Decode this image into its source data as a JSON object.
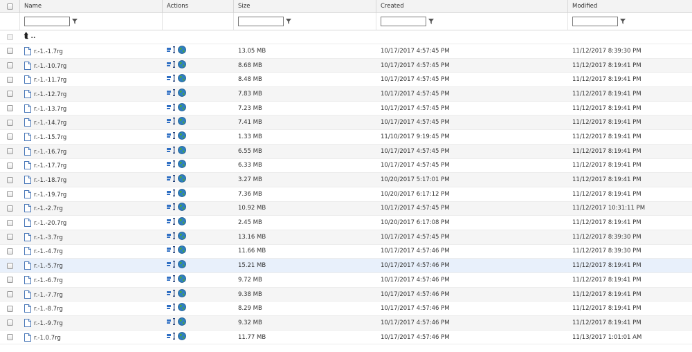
{
  "columns": {
    "name": "Name",
    "actions": "Actions",
    "size": "Size",
    "created": "Created",
    "modified": "Modified"
  },
  "parent_dir": {
    "label": ".."
  },
  "rows": [
    {
      "name": "r.-1.-1.7rg",
      "size": "13.05 MB",
      "created": "10/17/2017 4:57:45 PM",
      "modified": "11/12/2017 8:39:30 PM"
    },
    {
      "name": "r.-1.-10.7rg",
      "size": "8.68 MB",
      "created": "10/17/2017 4:57:45 PM",
      "modified": "11/12/2017 8:19:41 PM"
    },
    {
      "name": "r.-1.-11.7rg",
      "size": "8.48 MB",
      "created": "10/17/2017 4:57:45 PM",
      "modified": "11/12/2017 8:19:41 PM"
    },
    {
      "name": "r.-1.-12.7rg",
      "size": "7.83 MB",
      "created": "10/17/2017 4:57:45 PM",
      "modified": "11/12/2017 8:19:41 PM"
    },
    {
      "name": "r.-1.-13.7rg",
      "size": "7.23 MB",
      "created": "10/17/2017 4:57:45 PM",
      "modified": "11/12/2017 8:19:41 PM"
    },
    {
      "name": "r.-1.-14.7rg",
      "size": "7.41 MB",
      "created": "10/17/2017 4:57:45 PM",
      "modified": "11/12/2017 8:19:41 PM"
    },
    {
      "name": "r.-1.-15.7rg",
      "size": "1.33 MB",
      "created": "11/10/2017 9:19:45 PM",
      "modified": "11/12/2017 8:19:41 PM"
    },
    {
      "name": "r.-1.-16.7rg",
      "size": "6.55 MB",
      "created": "10/17/2017 4:57:45 PM",
      "modified": "11/12/2017 8:19:41 PM"
    },
    {
      "name": "r.-1.-17.7rg",
      "size": "6.33 MB",
      "created": "10/17/2017 4:57:45 PM",
      "modified": "11/12/2017 8:19:41 PM"
    },
    {
      "name": "r.-1.-18.7rg",
      "size": "3.27 MB",
      "created": "10/20/2017 5:17:01 PM",
      "modified": "11/12/2017 8:19:41 PM"
    },
    {
      "name": "r.-1.-19.7rg",
      "size": "7.36 MB",
      "created": "10/20/2017 6:17:12 PM",
      "modified": "11/12/2017 8:19:41 PM"
    },
    {
      "name": "r.-1.-2.7rg",
      "size": "10.92 MB",
      "created": "10/17/2017 4:57:45 PM",
      "modified": "11/12/2017 10:31:11 PM"
    },
    {
      "name": "r.-1.-20.7rg",
      "size": "2.45 MB",
      "created": "10/20/2017 6:17:08 PM",
      "modified": "11/12/2017 8:19:41 PM"
    },
    {
      "name": "r.-1.-3.7rg",
      "size": "13.16 MB",
      "created": "10/17/2017 4:57:45 PM",
      "modified": "11/12/2017 8:39:30 PM"
    },
    {
      "name": "r.-1.-4.7rg",
      "size": "11.66 MB",
      "created": "10/17/2017 4:57:46 PM",
      "modified": "11/12/2017 8:39:30 PM"
    },
    {
      "name": "r.-1.-5.7rg",
      "size": "15.21 MB",
      "created": "10/17/2017 4:57:46 PM",
      "modified": "11/12/2017 8:19:41 PM"
    },
    {
      "name": "r.-1.-6.7rg",
      "size": "9.72 MB",
      "created": "10/17/2017 4:57:46 PM",
      "modified": "11/12/2017 8:19:41 PM"
    },
    {
      "name": "r.-1.-7.7rg",
      "size": "9.38 MB",
      "created": "10/17/2017 4:57:46 PM",
      "modified": "11/12/2017 8:19:41 PM"
    },
    {
      "name": "r.-1.-8.7rg",
      "size": "8.29 MB",
      "created": "10/17/2017 4:57:46 PM",
      "modified": "11/12/2017 8:19:41 PM"
    },
    {
      "name": "r.-1.-9.7rg",
      "size": "9.32 MB",
      "created": "10/17/2017 4:57:46 PM",
      "modified": "11/12/2017 8:19:41 PM"
    },
    {
      "name": "r.-1.0.7rg",
      "size": "11.77 MB",
      "created": "10/17/2017 4:57:46 PM",
      "modified": "11/13/2017 1:01:01 AM"
    }
  ],
  "icons": {
    "file": "file-icon",
    "details": "details-icon",
    "web": "globe-icon",
    "filter": "filter-icon",
    "parent": "folder-up-icon"
  },
  "colors": {
    "header_bg": "#f3f3f3",
    "alt_row_bg": "#f5f5f5",
    "highlight_row_bg": "#e8f0fb",
    "grid_line": "#ececec"
  }
}
